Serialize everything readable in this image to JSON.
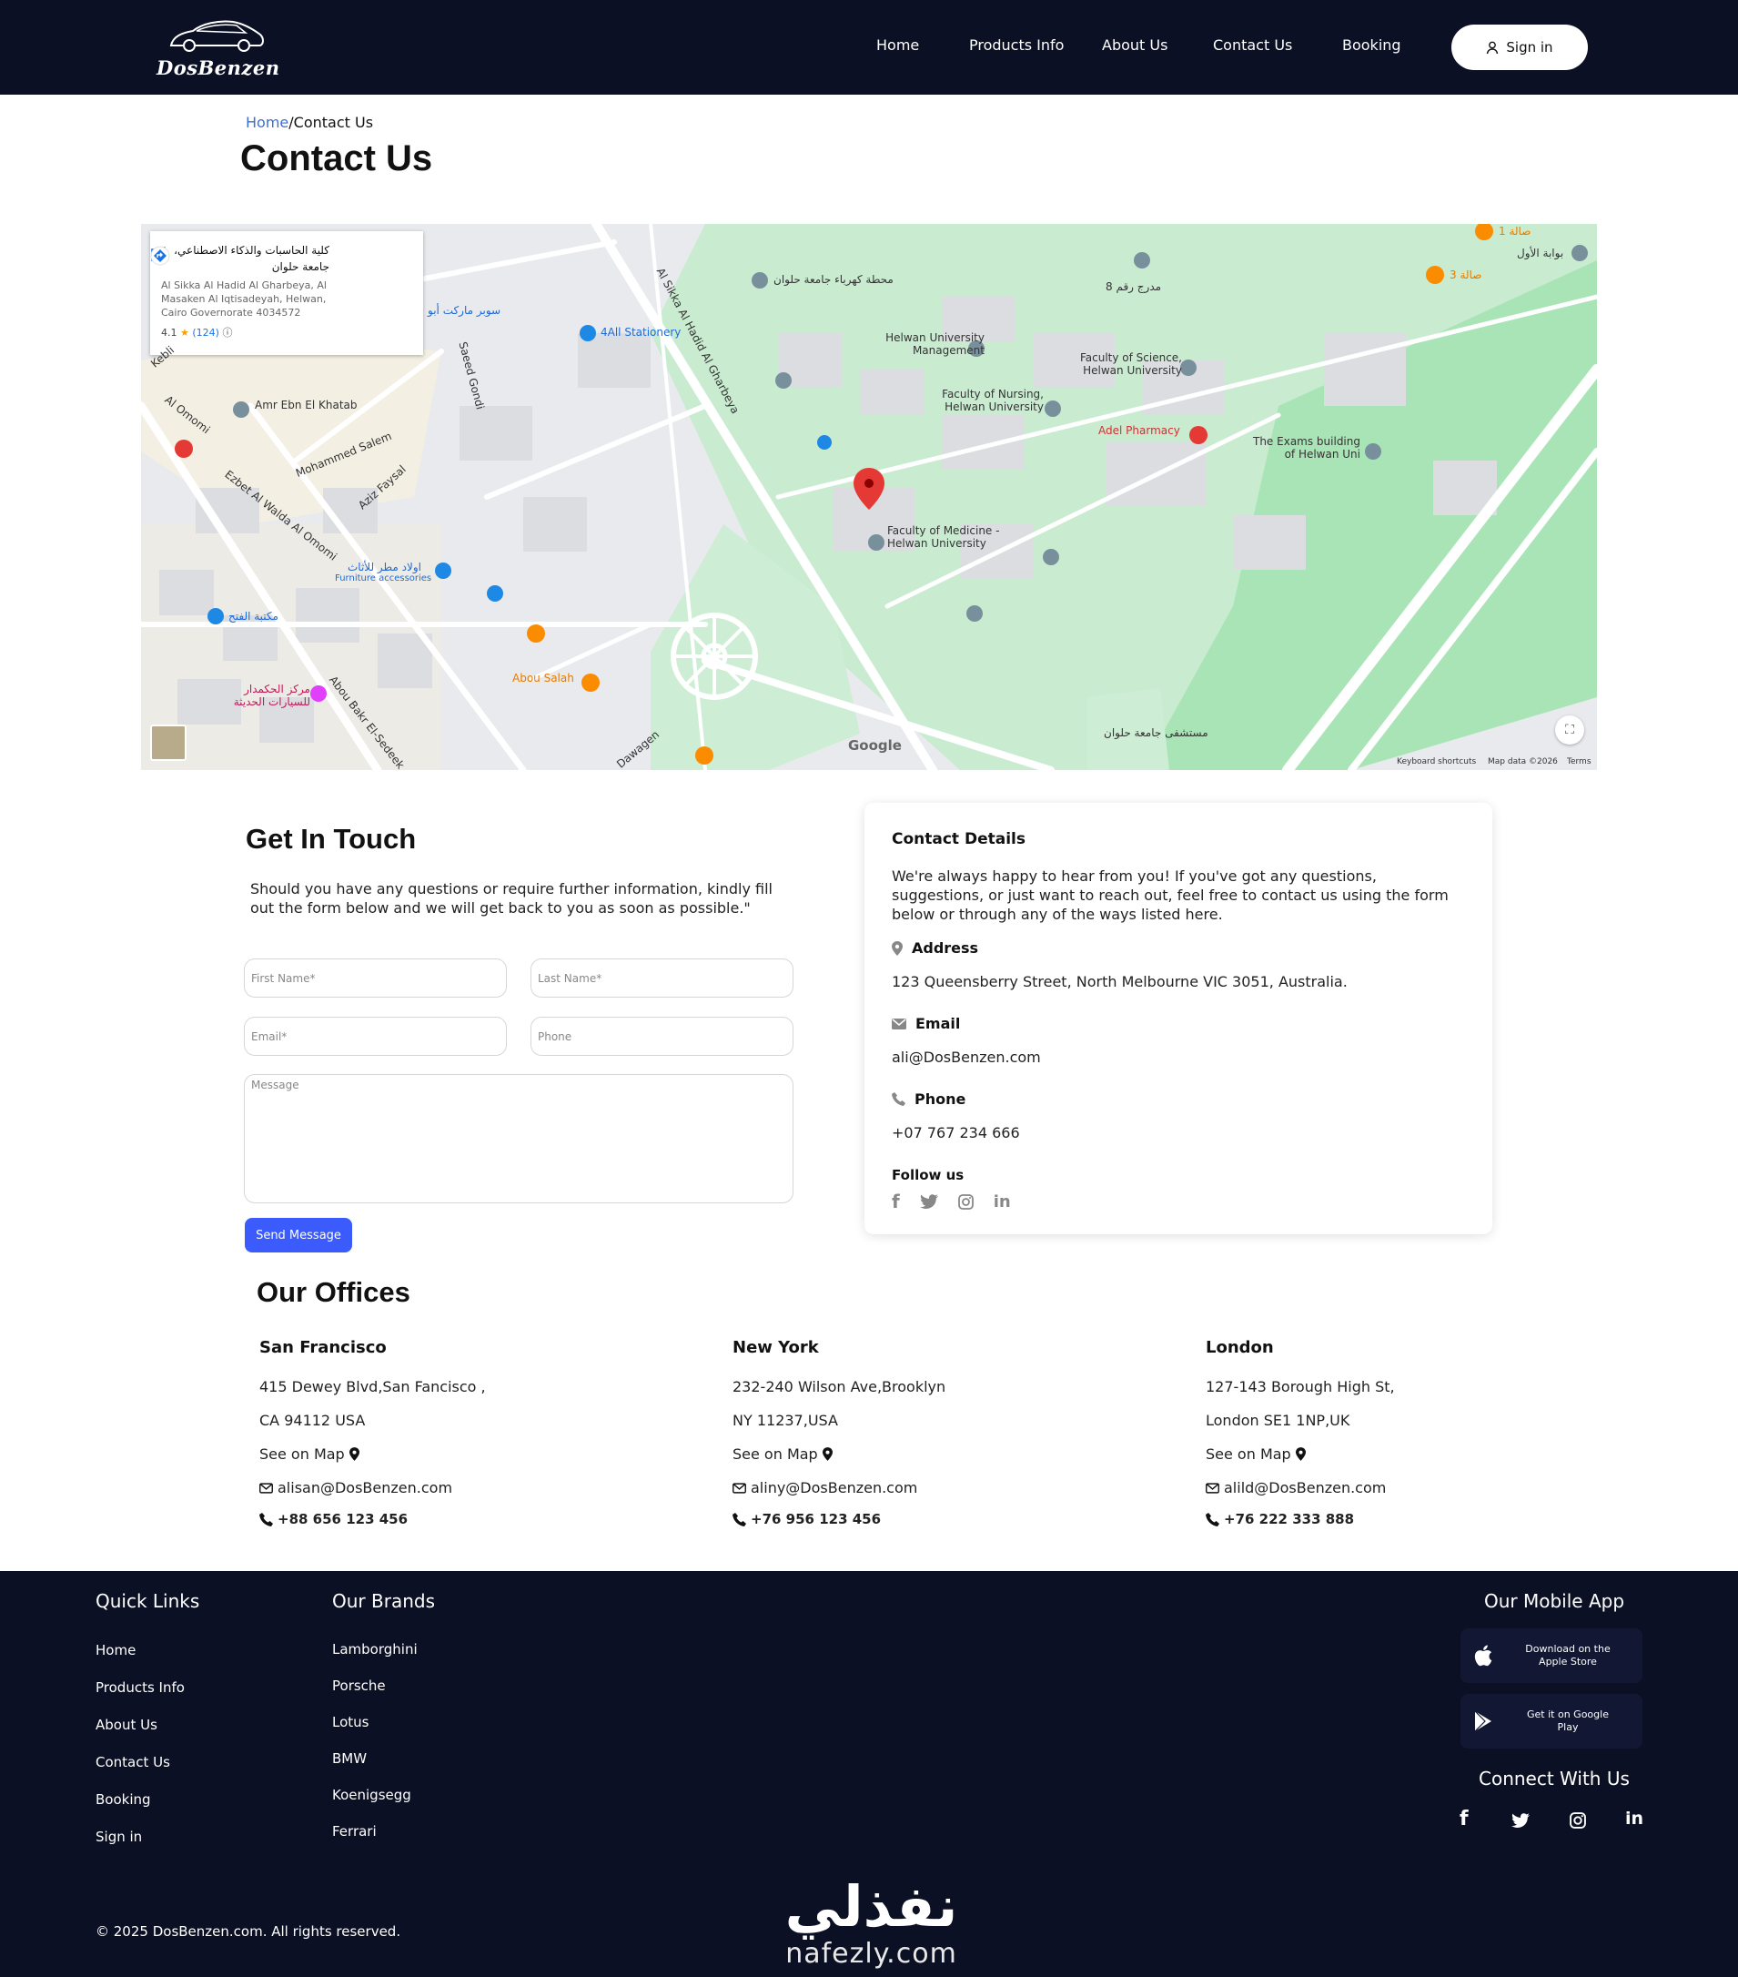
{
  "header": {
    "brand": "DosBenzen",
    "nav": [
      "Home",
      "Products Info",
      "About Us",
      "Contact Us",
      "Booking"
    ],
    "sign_in": "Sign in"
  },
  "breadcrumb": {
    "home": "Home",
    "current": "/Contact Us"
  },
  "page_title": "Contact Us",
  "map": {
    "place_name": "كلية الحاسبات والذكاء الاصطناعي، جامعة حلوان",
    "place_address": "Al Sikka Al Hadid Al Gharbeya, Al Masaken Al Iqtisadeyah, Helwan, Cairo Governorate 4034572",
    "rating": "4.1",
    "reviews": "(124)",
    "labels": {
      "l1": "4All Stationery",
      "l2": "Helwan University Management",
      "l3": "Faculty of Science, Helwan University",
      "l4": "Faculty of Nursing, Helwan University",
      "l5": "Adel Pharmacy",
      "l6": "The Exams building of Helwan Uni",
      "l7": "Faculty of Medicine - Helwan University",
      "l8": "Amr Ebn El Khatab",
      "l9": "Abou Salah",
      "l10": "Ezbet Al Walda Al Omomi",
      "l11": "Mohammed Salem",
      "l12": "Aziz Faysal",
      "l13": "Saeed Gondi",
      "l14": "Abou Bakr El-Sedeek",
      "l15": "Al Sikka Al Hadid Al Gharbeya",
      "l16": "مدرج رقم 8",
      "l17": "صالة 1",
      "l18": "صالة 3",
      "l19": "محطة كهرباء جامعة حلوان",
      "l20": "بوابة الأول",
      "l21": "مكتبة الفتح",
      "l22": "مركز الحكمدار للسيارات الحديثة",
      "l23": "مستشفى جامعة حلوان",
      "l24": "Furniture accessories",
      "l25": "اولاد مطر للأثاث",
      "l26": "سوبر ماركت أبو",
      "l27": "Dawagen",
      "l28": "Kebli",
      "l29": "Al Omomi",
      "l30": "Google"
    },
    "footer": {
      "shortcuts": "Keyboard shortcuts",
      "data": "Map data ©2026",
      "terms": "Terms"
    }
  },
  "get_in_touch": {
    "title": "Get In Touch",
    "description": "Should you have any questions or require further information, kindly fill out the form below and we will get back to you as soon as possible.\"",
    "first_name_placeholder": "First Name*",
    "last_name_placeholder": "Last Name*",
    "email_placeholder": "Email*",
    "phone_placeholder": "Phone",
    "message_placeholder": "Message",
    "send_label": "Send Message"
  },
  "contact_details": {
    "title": "Contact Details",
    "intro": "We're always happy to hear from you! If you've got any questions, suggestions, or just want to reach out, feel free to contact us using the form below or through any of the ways listed here.",
    "address_label": "Address",
    "address": "123 Queensberry Street, North Melbourne VIC 3051, Australia.",
    "email_label": "Email",
    "email": "ali@DosBenzen.com",
    "phone_label": "Phone",
    "phone": "+07 767 234 666",
    "follow_label": "Follow us"
  },
  "offices": {
    "title": "Our Offices",
    "list": [
      {
        "city": "San Francisco",
        "line1": "415 Dewey Blvd,San Fancisco ,",
        "line2": "CA 94112 USA",
        "map": "See on Map",
        "email": "alisan@DosBenzen.com",
        "phone": "+88 656 123 456"
      },
      {
        "city": "New York",
        "line1": "232-240 Wilson Ave,Brooklyn",
        "line2": "NY 11237,USA",
        "map": "See on Map",
        "email": "aliny@DosBenzen.com",
        "phone": "+76 956 123 456"
      },
      {
        "city": "London",
        "line1": "127-143 Borough High St,",
        "line2": "London SE1 1NP,UK",
        "map": "See on Map",
        "email": "alild@DosBenzen.com",
        "phone": "+76 222 333 888"
      }
    ]
  },
  "footer": {
    "quick_links_title": "Quick Links",
    "quick_links": [
      "Home",
      "Products Info",
      "About Us",
      "Contact Us",
      "Booking",
      "Sign in"
    ],
    "brands_title": "Our Brands",
    "brands": [
      "Lamborghini",
      "Porsche",
      "Lotus",
      "BMW",
      "Koenigsegg",
      "Ferrari"
    ],
    "app_title": "Our Mobile App",
    "apple_line1": "Download on the",
    "apple_line2": "Apple Store",
    "google_line1": "Get it on Google",
    "google_line2": "Play",
    "connect_title": "Connect With Us",
    "copyright": "© 2025 DosBenzen.com. All rights reserved.",
    "watermark_ar": "نفذلي",
    "watermark_en": "nafezly.com"
  },
  "colors": {
    "navy": "#0c1024",
    "accent": "#3b5bfd",
    "link": "#3b6fd8"
  }
}
